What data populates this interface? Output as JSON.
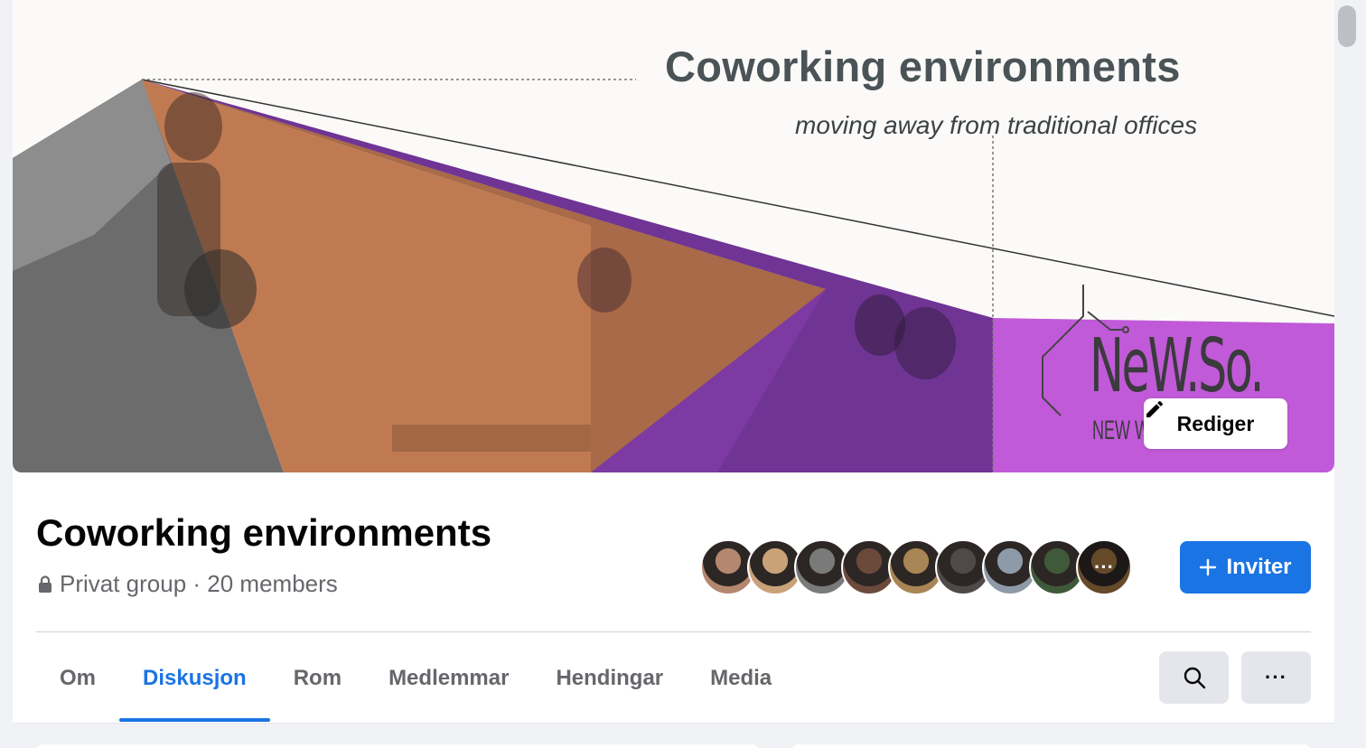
{
  "cover": {
    "title": "Coworking environments",
    "subtitle": "moving away from traditional offices",
    "logo_text": "NeW.So.",
    "logo_subtext": "NEW W",
    "edit_label": "Rediger",
    "edit_icon": "pencil-icon"
  },
  "group": {
    "name": "Coworking environments",
    "privacy_icon": "lock-icon",
    "meta": "Privat group · 20 members"
  },
  "members": {
    "avatar_colors": [
      "#b4876f",
      "#c9a27a",
      "#7a7a7a",
      "#6b4a3c",
      "#a88554",
      "#4f4a47",
      "#8f9aa8",
      "#3f5a3a",
      "#9c7040"
    ],
    "more_label": "···"
  },
  "invite": {
    "label": "Inviter",
    "icon": "plus-icon"
  },
  "tabs": [
    {
      "label": "Om",
      "active": false
    },
    {
      "label": "Diskusjon",
      "active": true
    },
    {
      "label": "Rom",
      "active": false
    },
    {
      "label": "Medlemmar",
      "active": false
    },
    {
      "label": "Hendingar",
      "active": false
    },
    {
      "label": "Media",
      "active": false
    }
  ],
  "actions": {
    "search_icon": "search-icon",
    "more_icon": "more-horizontal-icon",
    "more_label": "···"
  },
  "colors": {
    "accent": "#1b74e4",
    "purple": "#8e3fb3",
    "orange": "#c07a52",
    "light_purple": "#c15ad8"
  }
}
